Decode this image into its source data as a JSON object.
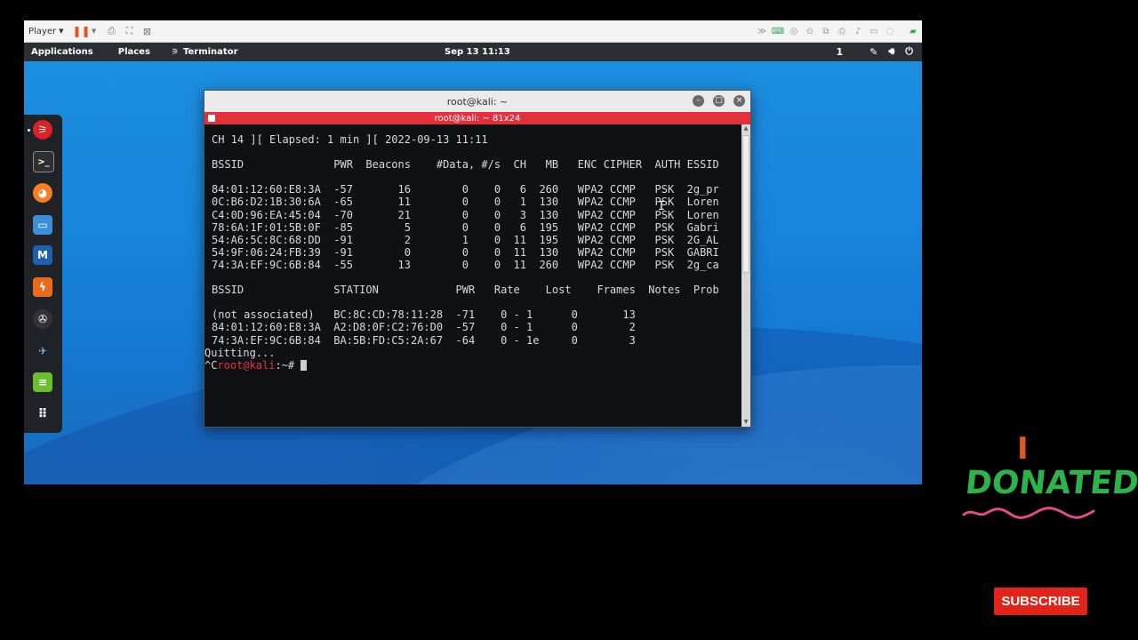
{
  "player": {
    "label": "Player",
    "icons": [
      "pause-icon",
      "send-ctrl-alt-del-icon",
      "fit-guest-icon",
      "unity-icon"
    ],
    "right_icons": [
      "chevron-right-icon",
      "usb-icon",
      "cd-icon",
      "network-icon",
      "printer-icon",
      "sound-icon",
      "display-icon",
      "usb2-icon",
      "message-icon"
    ]
  },
  "topbar": {
    "applications": "Applications",
    "places": "Places",
    "app_name": "Terminator",
    "clock": "Sep 13  11:13",
    "workspace": "1"
  },
  "dock": {
    "icons": [
      "terminator-icon",
      "terminal-icon",
      "firefox-icon",
      "files-icon",
      "metasploit-icon",
      "burpsuite-icon",
      "maltego-icon",
      "wireshark-icon",
      "text-editor-icon",
      "app-grid-icon"
    ]
  },
  "terminal": {
    "window_title": "root@kali: ~",
    "tab_title": "root@kali: ~ 81x24",
    "header_line": "CH 14 ][ Elapsed: 1 min ][ 2022-09-13 11:11",
    "ap_header": "BSSID              PWR  Beacons    #Data, #/s  CH   MB   ENC CIPHER  AUTH ESSID",
    "ap_rows": [
      "84:01:12:60:E8:3A  -57       16        0    0   6  260   WPA2 CCMP   PSK  2g_pr",
      "0C:B6:D2:1B:30:6A  -65       11        0    0   1  130   WPA2 CCMP   PSK  Loren",
      "C4:0D:96:EA:45:04  -70       21        0    0   3  130   WPA2 CCMP   PSK  Loren",
      "78:6A:1F:01:5B:0F  -85        5        0    0   6  195   WPA2 CCMP   PSK  Gabri",
      "54:A6:5C:8C:68:DD  -91        2        1    0  11  195   WPA2 CCMP   PSK  2G_AL",
      "54:9F:06:24:FB:39  -91        0        0    0  11  130   WPA2 CCMP   PSK  GABRI",
      "74:3A:EF:9C:6B:84  -55       13        0    0  11  260   WPA2 CCMP   PSK  2g_ca"
    ],
    "station_header": "BSSID              STATION            PWR   Rate    Lost    Frames  Notes  Prob",
    "station_rows": [
      "(not associated)   BC:8C:CD:78:11:28  -71    0 - 1      0       13",
      "84:01:12:60:E8:3A  A2:D8:0F:C2:76:D0  -57    0 - 1      0        2",
      "74:3A:EF:9C:6B:84  BA:5B:FD:C5:2A:67  -64    0 - 1e     0        3"
    ],
    "quit_line": "Quitting...",
    "prompt_prefix": "^C",
    "prompt_user": "root@kali",
    "prompt_suffix": ":~# "
  },
  "overlay": {
    "donated_i": "I",
    "donated_word": "DONATED",
    "subscribe": "SUBSCRIBE"
  }
}
